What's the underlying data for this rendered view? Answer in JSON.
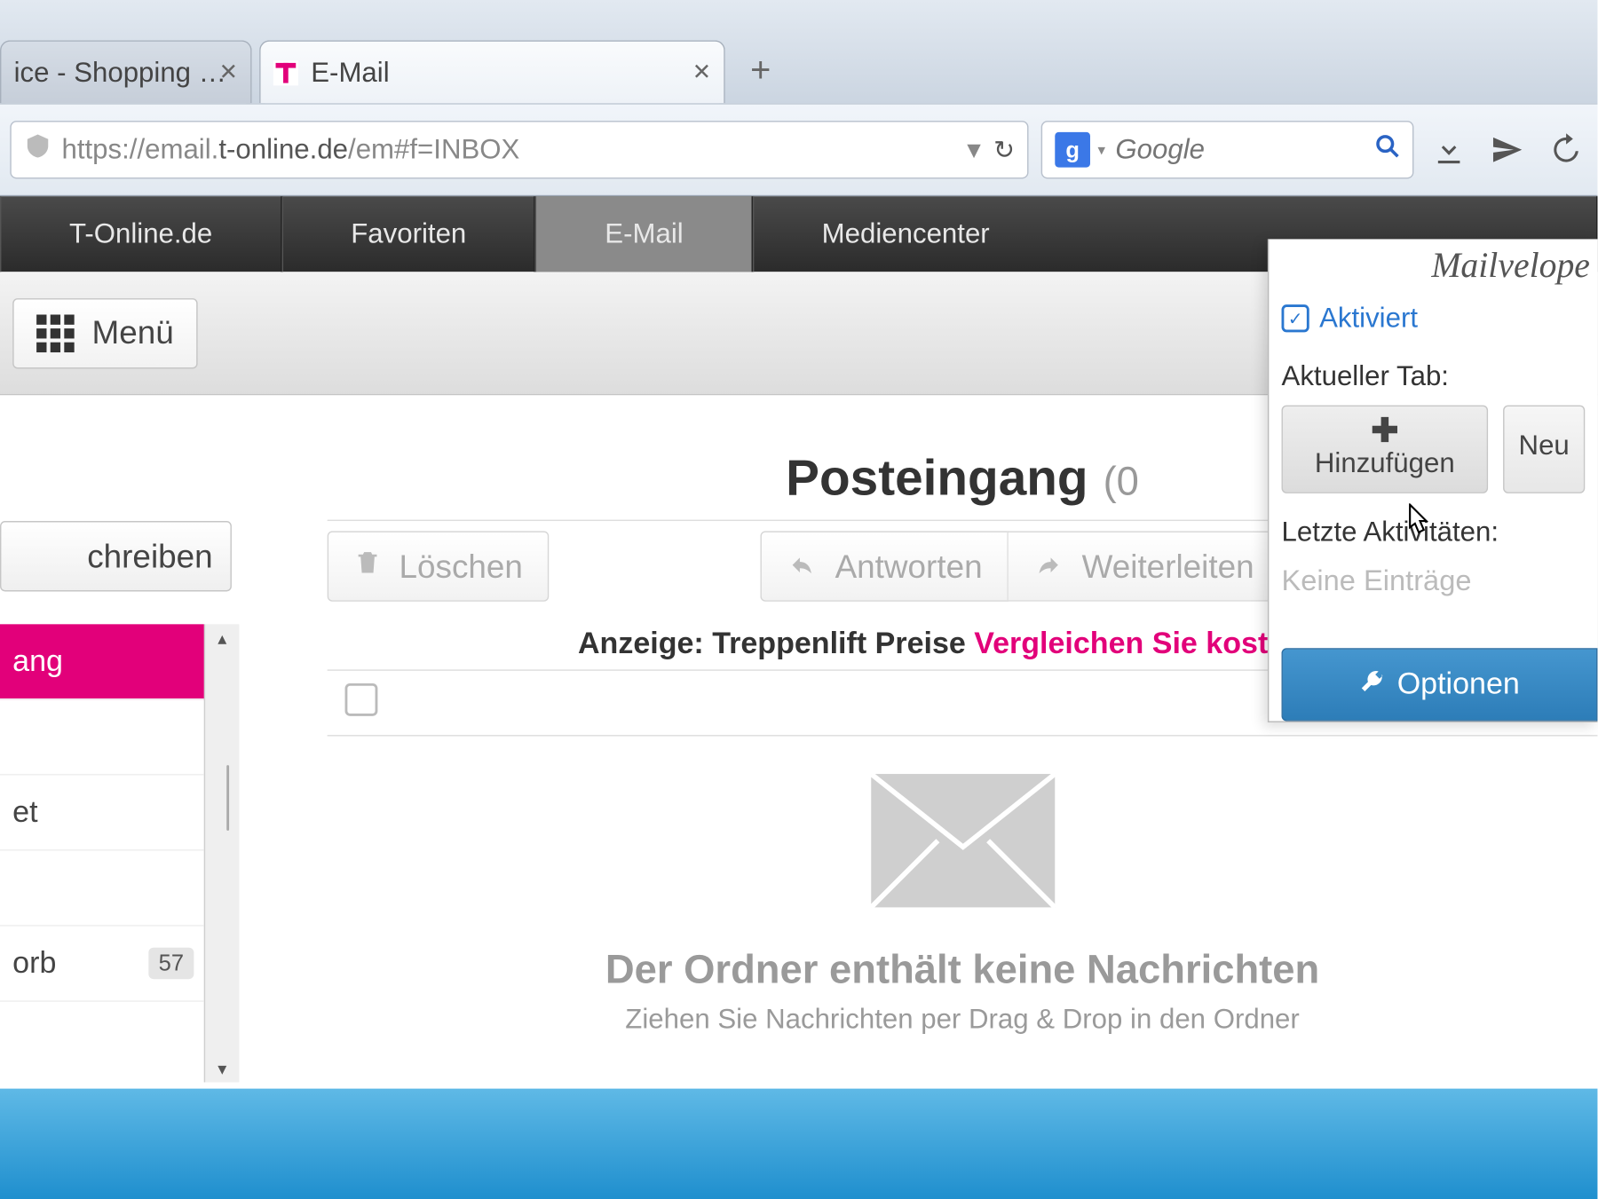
{
  "tabs": {
    "inactive_title": "ice - Shopping …",
    "active_title": "E-Mail"
  },
  "url": {
    "full": "https://email.t-online.de/em#f=INBOX",
    "host_styled_prefix": "https://email.",
    "host_styled_bold": "t-online.de",
    "host_styled_suffix": "/em#f=INBOX"
  },
  "search": {
    "placeholder": "Google"
  },
  "darknav": {
    "item1": "T-Online.de",
    "item2": "Favoriten",
    "item3": "E-Mail",
    "item4": "Mediencenter"
  },
  "menubar": {
    "menu": "Menü"
  },
  "sidebar": {
    "compose": "chreiben",
    "folders": {
      "inbox": "ang",
      "sent": "",
      "drafts": "et",
      "spam": "",
      "trash": "orb",
      "trash_badge": "57"
    }
  },
  "content": {
    "heading": "Posteingang",
    "count": "(0",
    "delete_btn": "Löschen",
    "reply_btn": "Antworten",
    "forward_btn": "Weiterleiten",
    "ad_prefix": "Anzeige: Treppenlift Preise",
    "ad_link": "Vergleichen Sie kostenlos",
    "empty_title": "Der Ordner enthält keine Nachrichten",
    "empty_sub": "Ziehen Sie Nachrichten per Drag & Drop in den Ordner"
  },
  "popup": {
    "brand": "Mailvelope",
    "activated": "Aktiviert",
    "current_tab": "Aktueller Tab:",
    "add_btn": "Hinzufügen",
    "reload_btn": "Neu",
    "recent": "Letzte Aktivitäten:",
    "recent_empty": "Keine Einträge",
    "options": "Optionen"
  }
}
